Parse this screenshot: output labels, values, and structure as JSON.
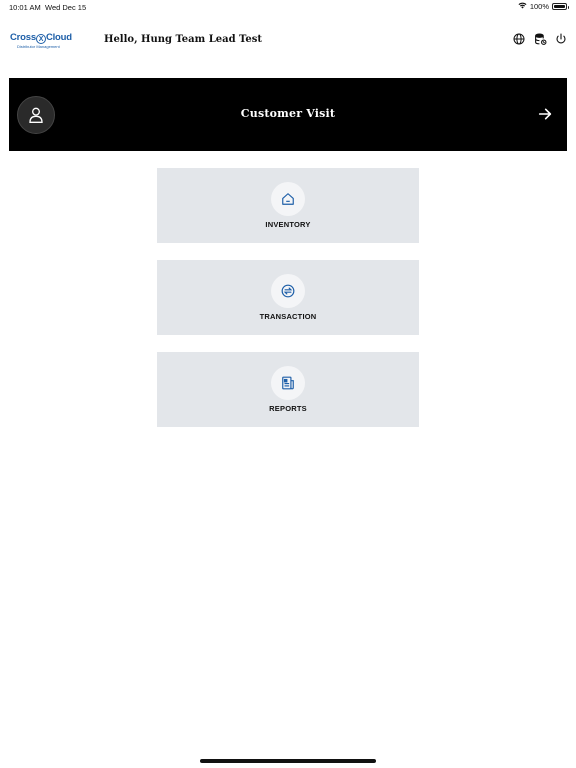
{
  "status_bar": {
    "time": "10:01 AM",
    "date": "Wed Dec 15",
    "battery": "100%",
    "battery_level": 1.0
  },
  "header": {
    "logo_brand_left": "Cross",
    "logo_brand_x": "X",
    "logo_brand_right": "Cloud",
    "logo_tagline": "Distributor Management",
    "greeting": "Hello,  Hung Team Lead Test",
    "icons": [
      "globe-icon",
      "database-sync-icon",
      "power-icon"
    ]
  },
  "banner": {
    "title": "Customer Visit",
    "icon": "user-icon",
    "action_icon": "arrow-right-icon"
  },
  "menu": [
    {
      "label": "INVENTORY",
      "icon": "home-icon"
    },
    {
      "label": "TRANSACTION",
      "icon": "exchange-icon"
    },
    {
      "label": "REPORTS",
      "icon": "report-icon"
    }
  ],
  "colors": {
    "accent": "#1e5fa8",
    "banner_bg": "#000000",
    "card_bg": "#e3e6ea"
  }
}
